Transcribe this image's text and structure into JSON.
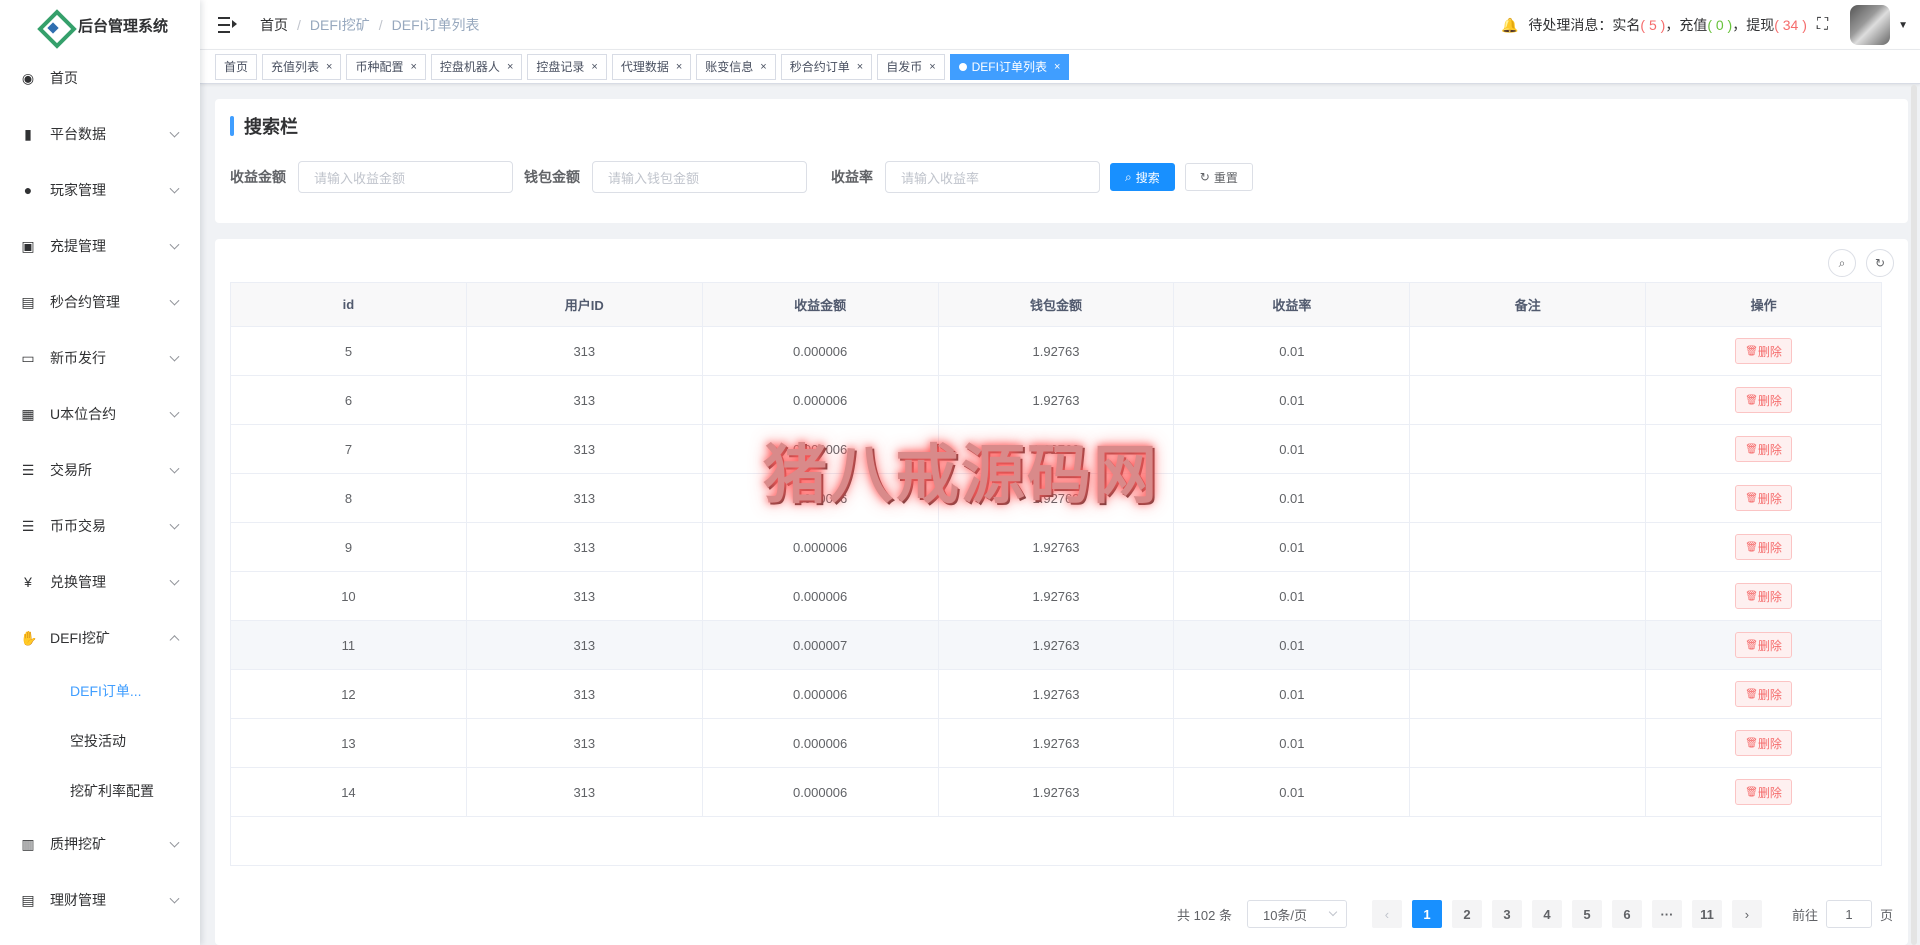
{
  "app": {
    "title": "后台管理系统"
  },
  "sidebar": {
    "items": [
      {
        "label": "首页",
        "icon": "dashboard-icon",
        "glyph": "◉"
      },
      {
        "label": "平台数据",
        "icon": "book-icon",
        "glyph": "▮"
      },
      {
        "label": "玩家管理",
        "icon": "user-icon",
        "glyph": "●"
      },
      {
        "label": "充提管理",
        "icon": "copy-icon",
        "glyph": "▣"
      },
      {
        "label": "秒合约管理",
        "icon": "chart-icon",
        "glyph": "▤"
      },
      {
        "label": "新币发行",
        "icon": "tools-icon",
        "glyph": "▭"
      },
      {
        "label": "U本位合约",
        "icon": "grid-icon",
        "glyph": "▦"
      },
      {
        "label": "交易所",
        "icon": "list-icon",
        "glyph": "☰"
      },
      {
        "label": "币币交易",
        "icon": "list-icon",
        "glyph": "☰"
      },
      {
        "label": "兑换管理",
        "icon": "yen-icon",
        "glyph": "¥"
      },
      {
        "label": "DEFI挖矿",
        "icon": "hand-icon",
        "glyph": "✋"
      }
    ],
    "defi_sub": [
      {
        "label": "DEFI订单..."
      },
      {
        "label": "空投活动"
      },
      {
        "label": "挖矿利率配置"
      }
    ],
    "bottom_items": [
      {
        "label": "质押挖矿",
        "icon": "bar-chart-icon",
        "glyph": "▥"
      },
      {
        "label": "理财管理",
        "icon": "document-icon",
        "glyph": "▤"
      }
    ]
  },
  "navbar": {
    "breadcrumb": [
      "首页",
      "DEFI挖矿",
      "DEFI订单列表"
    ],
    "separator": "/",
    "pending": {
      "prefix": "待处理消息：",
      "realname_label": "实名",
      "realname_count": "( 5 )",
      "recharge_label": "充值",
      "recharge_count": "( 0 )",
      "withdraw_label": "提现",
      "withdraw_count": "( 34 )",
      "comma": "，"
    }
  },
  "tags": [
    "首页",
    "充值列表",
    "币种配置",
    "控盘机器人",
    "控盘记录",
    "代理数据",
    "账变信息",
    "秒合约订单",
    "自发币"
  ],
  "active_tag": "DEFI订单列表",
  "search": {
    "title": "搜索栏",
    "fields": [
      {
        "label": "收益金额",
        "placeholder": "请输入收益金额"
      },
      {
        "label": "钱包金额",
        "placeholder": "请输入钱包金额"
      },
      {
        "label": "收益率",
        "placeholder": "请输入收益率"
      }
    ],
    "search_btn": "搜索",
    "reset_btn": "重置"
  },
  "table": {
    "columns": [
      "id",
      "用户ID",
      "收益金额",
      "钱包金额",
      "收益率",
      "备注",
      "操作"
    ],
    "rows": [
      [
        "5",
        "313",
        "0.000006",
        "1.92763",
        "0.01",
        ""
      ],
      [
        "6",
        "313",
        "0.000006",
        "1.92763",
        "0.01",
        ""
      ],
      [
        "7",
        "313",
        "0.000006",
        "1.92763",
        "0.01",
        ""
      ],
      [
        "8",
        "313",
        "0.000006",
        "1.92763",
        "0.01",
        ""
      ],
      [
        "9",
        "313",
        "0.000006",
        "1.92763",
        "0.01",
        ""
      ],
      [
        "10",
        "313",
        "0.000006",
        "1.92763",
        "0.01",
        ""
      ],
      [
        "11",
        "313",
        "0.000007",
        "1.92763",
        "0.01",
        ""
      ],
      [
        "12",
        "313",
        "0.000006",
        "1.92763",
        "0.01",
        ""
      ],
      [
        "13",
        "313",
        "0.000006",
        "1.92763",
        "0.01",
        ""
      ],
      [
        "14",
        "313",
        "0.000006",
        "1.92763",
        "0.01",
        ""
      ]
    ],
    "delete_label": "删除"
  },
  "pagination": {
    "total": "共 102 条",
    "page_size": "10条/页",
    "pages": [
      "1",
      "2",
      "3",
      "4",
      "5",
      "6",
      "···",
      "11"
    ],
    "current": "1",
    "goto_prefix": "前往",
    "goto_value": "1",
    "goto_suffix": "页"
  },
  "watermark": "猪八戒源码网",
  "colors": {
    "primary": "#1890ff",
    "danger": "#f56c6c",
    "success": "#67c23a",
    "brand_green": "#35a06b"
  }
}
